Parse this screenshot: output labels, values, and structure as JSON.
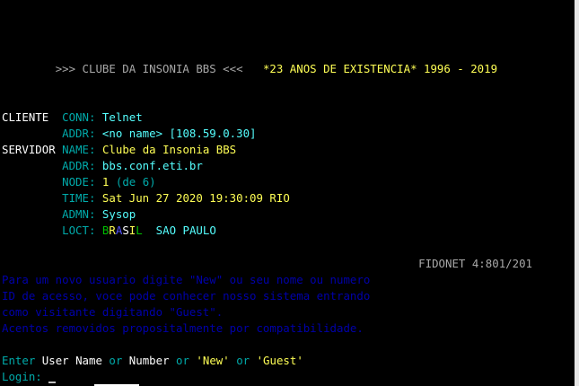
{
  "header": {
    "board_title": ">>> CLUBE DA INSONIA BBS <<<",
    "anniversary": "*23 ANOS DE EXISTENCIA*",
    "years": "1996 - 2019"
  },
  "client": {
    "section_label": "CLIENTE",
    "conn_label": "CONN:",
    "conn_value": "Telnet",
    "addr_label": "ADDR:",
    "addr_value": "<no name> [108.59.0.30]"
  },
  "server": {
    "section_label": "SERVIDOR",
    "name_label": "NAME:",
    "name_value": "Clube da Insonia BBS",
    "addr_label": "ADDR:",
    "addr_value": "bbs.conf.eti.br",
    "node_label": "NODE:",
    "node_value": "1",
    "node_total": "(de 6)",
    "time_label": "TIME:",
    "time_value": "Sat Jun 27 2020 19:30:09 RIO",
    "admn_label": "ADMN:",
    "admn_value": "Sysop",
    "loct_label": "LOCT:",
    "loct_country": [
      "B",
      "R",
      "A",
      "S",
      "I",
      "L"
    ],
    "loct_city": "SAO PAULO"
  },
  "fidonet": "FIDONET 4:801/201",
  "notice": [
    "Para um novo usuario digite \"New\" ou seu nome ou numero",
    "ID de acesso, voce pode conhecer nosso sistema entrando",
    "como visitante digitando \"Guest\".",
    "Acentos removidos propositalmente por compatibilidade."
  ],
  "prompt": {
    "enter": "Enter",
    "user_name": "User Name",
    "or1": "or",
    "number": "Number",
    "or2": "or",
    "new": "'New'",
    "or3": "or",
    "guest": "'Guest'",
    "login_label": "Login:"
  },
  "colors": {
    "background": "#000000",
    "label": "#00aaaa",
    "value": "#ffff55",
    "notice": "#0000aa"
  }
}
